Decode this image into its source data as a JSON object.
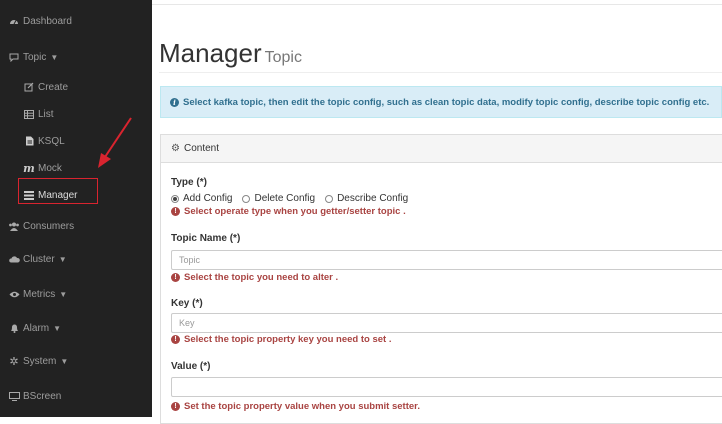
{
  "sidebar": {
    "items": [
      {
        "label": "Dashboard",
        "icon": "dashboard-icon"
      },
      {
        "label": "Topic",
        "icon": "topic-icon",
        "caret": "▼"
      },
      {
        "label": "Create",
        "icon": "edit-icon"
      },
      {
        "label": "List",
        "icon": "list-icon"
      },
      {
        "label": "KSQL",
        "icon": "file-icon"
      },
      {
        "label": "Mock",
        "icon": "mock-icon",
        "glyph": "m"
      },
      {
        "label": "Manager",
        "icon": "manager-icon"
      },
      {
        "label": "Consumers",
        "icon": "users-icon"
      },
      {
        "label": "Cluster",
        "icon": "cloud-icon",
        "caret": "▼"
      },
      {
        "label": "Metrics",
        "icon": "eye-icon",
        "caret": "▼"
      },
      {
        "label": "Alarm",
        "icon": "bell-icon",
        "caret": "▼"
      },
      {
        "label": "System",
        "icon": "gear-icon",
        "caret": "▼"
      },
      {
        "label": "BScreen",
        "icon": "monitor-icon"
      }
    ],
    "highlight_color": "#d9242f"
  },
  "header": {
    "title": "Manager",
    "subtitle": "Topic"
  },
  "alert": {
    "text": "Select kafka topic, then edit the topic config, such as clean topic data, modify topic config, describe topic config etc."
  },
  "panel": {
    "heading": "Content",
    "type": {
      "label": "Type (*)",
      "options": [
        "Add Config",
        "Delete Config",
        "Describe Config"
      ],
      "selected": "Add Config",
      "help": "Select operate type when you getter/setter topic ."
    },
    "topic_name": {
      "label": "Topic Name (*)",
      "placeholder": "Topic",
      "help": "Select the topic you need to alter ."
    },
    "key": {
      "label": "Key (*)",
      "placeholder": "Key",
      "help": "Select the topic property key you need to set ."
    },
    "value": {
      "label": "Value (*)",
      "placeholder": "",
      "help": "Set the topic property value when you submit setter."
    }
  }
}
